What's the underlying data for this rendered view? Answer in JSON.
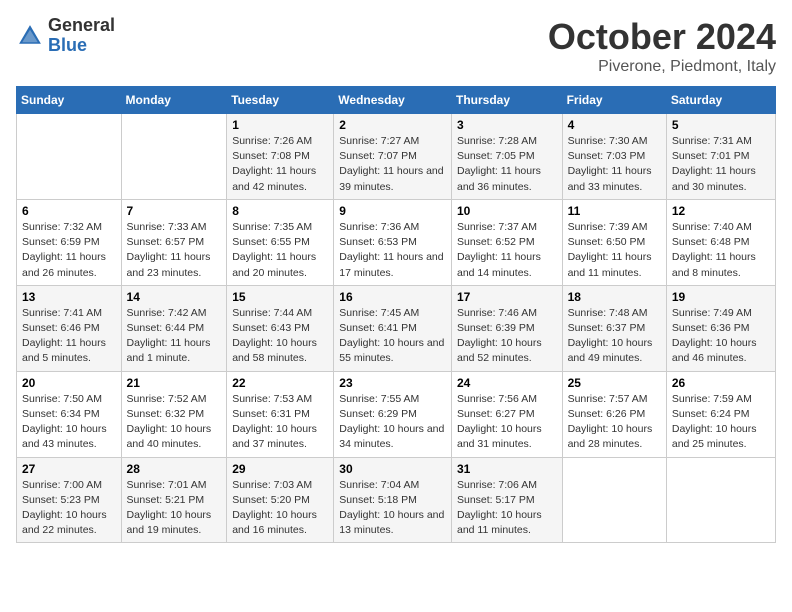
{
  "header": {
    "logo_general": "General",
    "logo_blue": "Blue",
    "month_title": "October 2024",
    "location": "Piverone, Piedmont, Italy"
  },
  "columns": [
    "Sunday",
    "Monday",
    "Tuesday",
    "Wednesday",
    "Thursday",
    "Friday",
    "Saturday"
  ],
  "weeks": [
    [
      {
        "day": "",
        "sunrise": "",
        "sunset": "",
        "daylight": ""
      },
      {
        "day": "",
        "sunrise": "",
        "sunset": "",
        "daylight": ""
      },
      {
        "day": "1",
        "sunrise": "Sunrise: 7:26 AM",
        "sunset": "Sunset: 7:08 PM",
        "daylight": "Daylight: 11 hours and 42 minutes."
      },
      {
        "day": "2",
        "sunrise": "Sunrise: 7:27 AM",
        "sunset": "Sunset: 7:07 PM",
        "daylight": "Daylight: 11 hours and 39 minutes."
      },
      {
        "day": "3",
        "sunrise": "Sunrise: 7:28 AM",
        "sunset": "Sunset: 7:05 PM",
        "daylight": "Daylight: 11 hours and 36 minutes."
      },
      {
        "day": "4",
        "sunrise": "Sunrise: 7:30 AM",
        "sunset": "Sunset: 7:03 PM",
        "daylight": "Daylight: 11 hours and 33 minutes."
      },
      {
        "day": "5",
        "sunrise": "Sunrise: 7:31 AM",
        "sunset": "Sunset: 7:01 PM",
        "daylight": "Daylight: 11 hours and 30 minutes."
      }
    ],
    [
      {
        "day": "6",
        "sunrise": "Sunrise: 7:32 AM",
        "sunset": "Sunset: 6:59 PM",
        "daylight": "Daylight: 11 hours and 26 minutes."
      },
      {
        "day": "7",
        "sunrise": "Sunrise: 7:33 AM",
        "sunset": "Sunset: 6:57 PM",
        "daylight": "Daylight: 11 hours and 23 minutes."
      },
      {
        "day": "8",
        "sunrise": "Sunrise: 7:35 AM",
        "sunset": "Sunset: 6:55 PM",
        "daylight": "Daylight: 11 hours and 20 minutes."
      },
      {
        "day": "9",
        "sunrise": "Sunrise: 7:36 AM",
        "sunset": "Sunset: 6:53 PM",
        "daylight": "Daylight: 11 hours and 17 minutes."
      },
      {
        "day": "10",
        "sunrise": "Sunrise: 7:37 AM",
        "sunset": "Sunset: 6:52 PM",
        "daylight": "Daylight: 11 hours and 14 minutes."
      },
      {
        "day": "11",
        "sunrise": "Sunrise: 7:39 AM",
        "sunset": "Sunset: 6:50 PM",
        "daylight": "Daylight: 11 hours and 11 minutes."
      },
      {
        "day": "12",
        "sunrise": "Sunrise: 7:40 AM",
        "sunset": "Sunset: 6:48 PM",
        "daylight": "Daylight: 11 hours and 8 minutes."
      }
    ],
    [
      {
        "day": "13",
        "sunrise": "Sunrise: 7:41 AM",
        "sunset": "Sunset: 6:46 PM",
        "daylight": "Daylight: 11 hours and 5 minutes."
      },
      {
        "day": "14",
        "sunrise": "Sunrise: 7:42 AM",
        "sunset": "Sunset: 6:44 PM",
        "daylight": "Daylight: 11 hours and 1 minute."
      },
      {
        "day": "15",
        "sunrise": "Sunrise: 7:44 AM",
        "sunset": "Sunset: 6:43 PM",
        "daylight": "Daylight: 10 hours and 58 minutes."
      },
      {
        "day": "16",
        "sunrise": "Sunrise: 7:45 AM",
        "sunset": "Sunset: 6:41 PM",
        "daylight": "Daylight: 10 hours and 55 minutes."
      },
      {
        "day": "17",
        "sunrise": "Sunrise: 7:46 AM",
        "sunset": "Sunset: 6:39 PM",
        "daylight": "Daylight: 10 hours and 52 minutes."
      },
      {
        "day": "18",
        "sunrise": "Sunrise: 7:48 AM",
        "sunset": "Sunset: 6:37 PM",
        "daylight": "Daylight: 10 hours and 49 minutes."
      },
      {
        "day": "19",
        "sunrise": "Sunrise: 7:49 AM",
        "sunset": "Sunset: 6:36 PM",
        "daylight": "Daylight: 10 hours and 46 minutes."
      }
    ],
    [
      {
        "day": "20",
        "sunrise": "Sunrise: 7:50 AM",
        "sunset": "Sunset: 6:34 PM",
        "daylight": "Daylight: 10 hours and 43 minutes."
      },
      {
        "day": "21",
        "sunrise": "Sunrise: 7:52 AM",
        "sunset": "Sunset: 6:32 PM",
        "daylight": "Daylight: 10 hours and 40 minutes."
      },
      {
        "day": "22",
        "sunrise": "Sunrise: 7:53 AM",
        "sunset": "Sunset: 6:31 PM",
        "daylight": "Daylight: 10 hours and 37 minutes."
      },
      {
        "day": "23",
        "sunrise": "Sunrise: 7:55 AM",
        "sunset": "Sunset: 6:29 PM",
        "daylight": "Daylight: 10 hours and 34 minutes."
      },
      {
        "day": "24",
        "sunrise": "Sunrise: 7:56 AM",
        "sunset": "Sunset: 6:27 PM",
        "daylight": "Daylight: 10 hours and 31 minutes."
      },
      {
        "day": "25",
        "sunrise": "Sunrise: 7:57 AM",
        "sunset": "Sunset: 6:26 PM",
        "daylight": "Daylight: 10 hours and 28 minutes."
      },
      {
        "day": "26",
        "sunrise": "Sunrise: 7:59 AM",
        "sunset": "Sunset: 6:24 PM",
        "daylight": "Daylight: 10 hours and 25 minutes."
      }
    ],
    [
      {
        "day": "27",
        "sunrise": "Sunrise: 7:00 AM",
        "sunset": "Sunset: 5:23 PM",
        "daylight": "Daylight: 10 hours and 22 minutes."
      },
      {
        "day": "28",
        "sunrise": "Sunrise: 7:01 AM",
        "sunset": "Sunset: 5:21 PM",
        "daylight": "Daylight: 10 hours and 19 minutes."
      },
      {
        "day": "29",
        "sunrise": "Sunrise: 7:03 AM",
        "sunset": "Sunset: 5:20 PM",
        "daylight": "Daylight: 10 hours and 16 minutes."
      },
      {
        "day": "30",
        "sunrise": "Sunrise: 7:04 AM",
        "sunset": "Sunset: 5:18 PM",
        "daylight": "Daylight: 10 hours and 13 minutes."
      },
      {
        "day": "31",
        "sunrise": "Sunrise: 7:06 AM",
        "sunset": "Sunset: 5:17 PM",
        "daylight": "Daylight: 10 hours and 11 minutes."
      },
      {
        "day": "",
        "sunrise": "",
        "sunset": "",
        "daylight": ""
      },
      {
        "day": "",
        "sunrise": "",
        "sunset": "",
        "daylight": ""
      }
    ]
  ]
}
